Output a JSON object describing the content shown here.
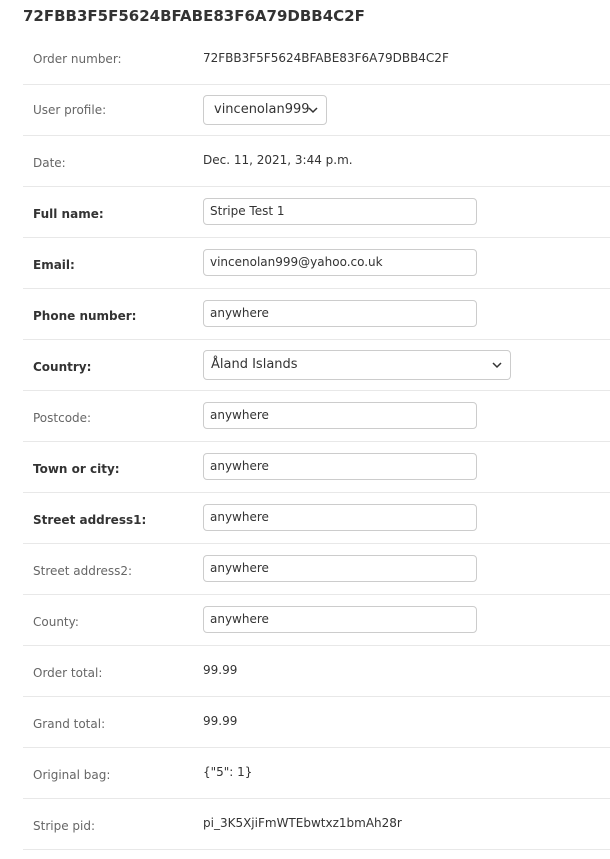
{
  "header": {
    "title": "72FBB3F5F5624BFABE83F6A79DBB4C2F"
  },
  "form": {
    "order_number": {
      "label": "Order number:",
      "value": "72FBB3F5F5624BFABE83F6A79DBB4C2F"
    },
    "user_profile": {
      "label": "User profile:",
      "value": "vincenolan999"
    },
    "date": {
      "label": "Date:",
      "value": "Dec. 11, 2021, 3:44 p.m."
    },
    "full_name": {
      "label": "Full name:",
      "value": "Stripe Test 1"
    },
    "email": {
      "label": "Email:",
      "value": "vincenolan999@yahoo.co.uk"
    },
    "phone_number": {
      "label": "Phone number:",
      "value": "anywhere"
    },
    "country": {
      "label": "Country:",
      "value": "Åland Islands"
    },
    "postcode": {
      "label": "Postcode:",
      "value": "anywhere"
    },
    "town_or_city": {
      "label": "Town or city:",
      "value": "anywhere"
    },
    "street_address1": {
      "label": "Street address1:",
      "value": "anywhere"
    },
    "street_address2": {
      "label": "Street address2:",
      "value": "anywhere"
    },
    "county": {
      "label": "County:",
      "value": "anywhere"
    },
    "order_total": {
      "label": "Order total:",
      "value": "99.99"
    },
    "grand_total": {
      "label": "Grand total:",
      "value": "99.99"
    },
    "original_bag": {
      "label": "Original bag:",
      "value": "{\"5\": 1}"
    },
    "stripe_pid": {
      "label": "Stripe pid:",
      "value": "pi_3K5XjiFmWTEbwtxz1bmAh28r"
    }
  },
  "icons": {
    "select_arrow": "chevron-down-icon"
  }
}
